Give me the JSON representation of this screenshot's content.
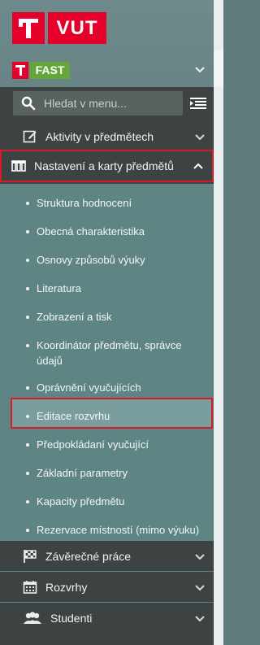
{
  "header": {
    "university_logo_text": "VUT",
    "faculty_logo_text": "FAST"
  },
  "search": {
    "placeholder": "Hledat v menu..."
  },
  "menu": {
    "items_top": [
      {
        "label": "Aktivity v předmětech",
        "icon": "edit-icon"
      },
      {
        "label": "Nastavení a karty předmětů",
        "icon": "columns-icon",
        "expanded": true
      }
    ],
    "subitems": [
      {
        "label": "Struktura hodnocení"
      },
      {
        "label": "Obecná charakteristika"
      },
      {
        "label": "Osnovy způsobů výuky"
      },
      {
        "label": "Literatura"
      },
      {
        "label": "Zobrazení a tisk"
      },
      {
        "label": "Koordinátor předmětu, správce údajů"
      },
      {
        "label": "Oprávnění vyučujících"
      },
      {
        "label": "Editace rozvrhu",
        "highlighted": true
      },
      {
        "label": "Předpokládaní vyučující"
      },
      {
        "label": "Základní parametry"
      },
      {
        "label": "Kapacity předmětu"
      },
      {
        "label": "Rezervace místností (mimo výuku)"
      }
    ],
    "items_bottom": [
      {
        "label": "Závěrečné práce",
        "icon": "flag-checkered-icon"
      },
      {
        "label": "Rozvrhy",
        "icon": "calendar-icon"
      },
      {
        "label": "Studenti",
        "icon": "users-icon"
      }
    ]
  },
  "colors": {
    "brand_red": "#e4002b",
    "fast_green": "#65a63b",
    "panel_dark": "#3d4343",
    "submenu_teal": "#5f8484",
    "highlight_border": "#d81b2b"
  }
}
